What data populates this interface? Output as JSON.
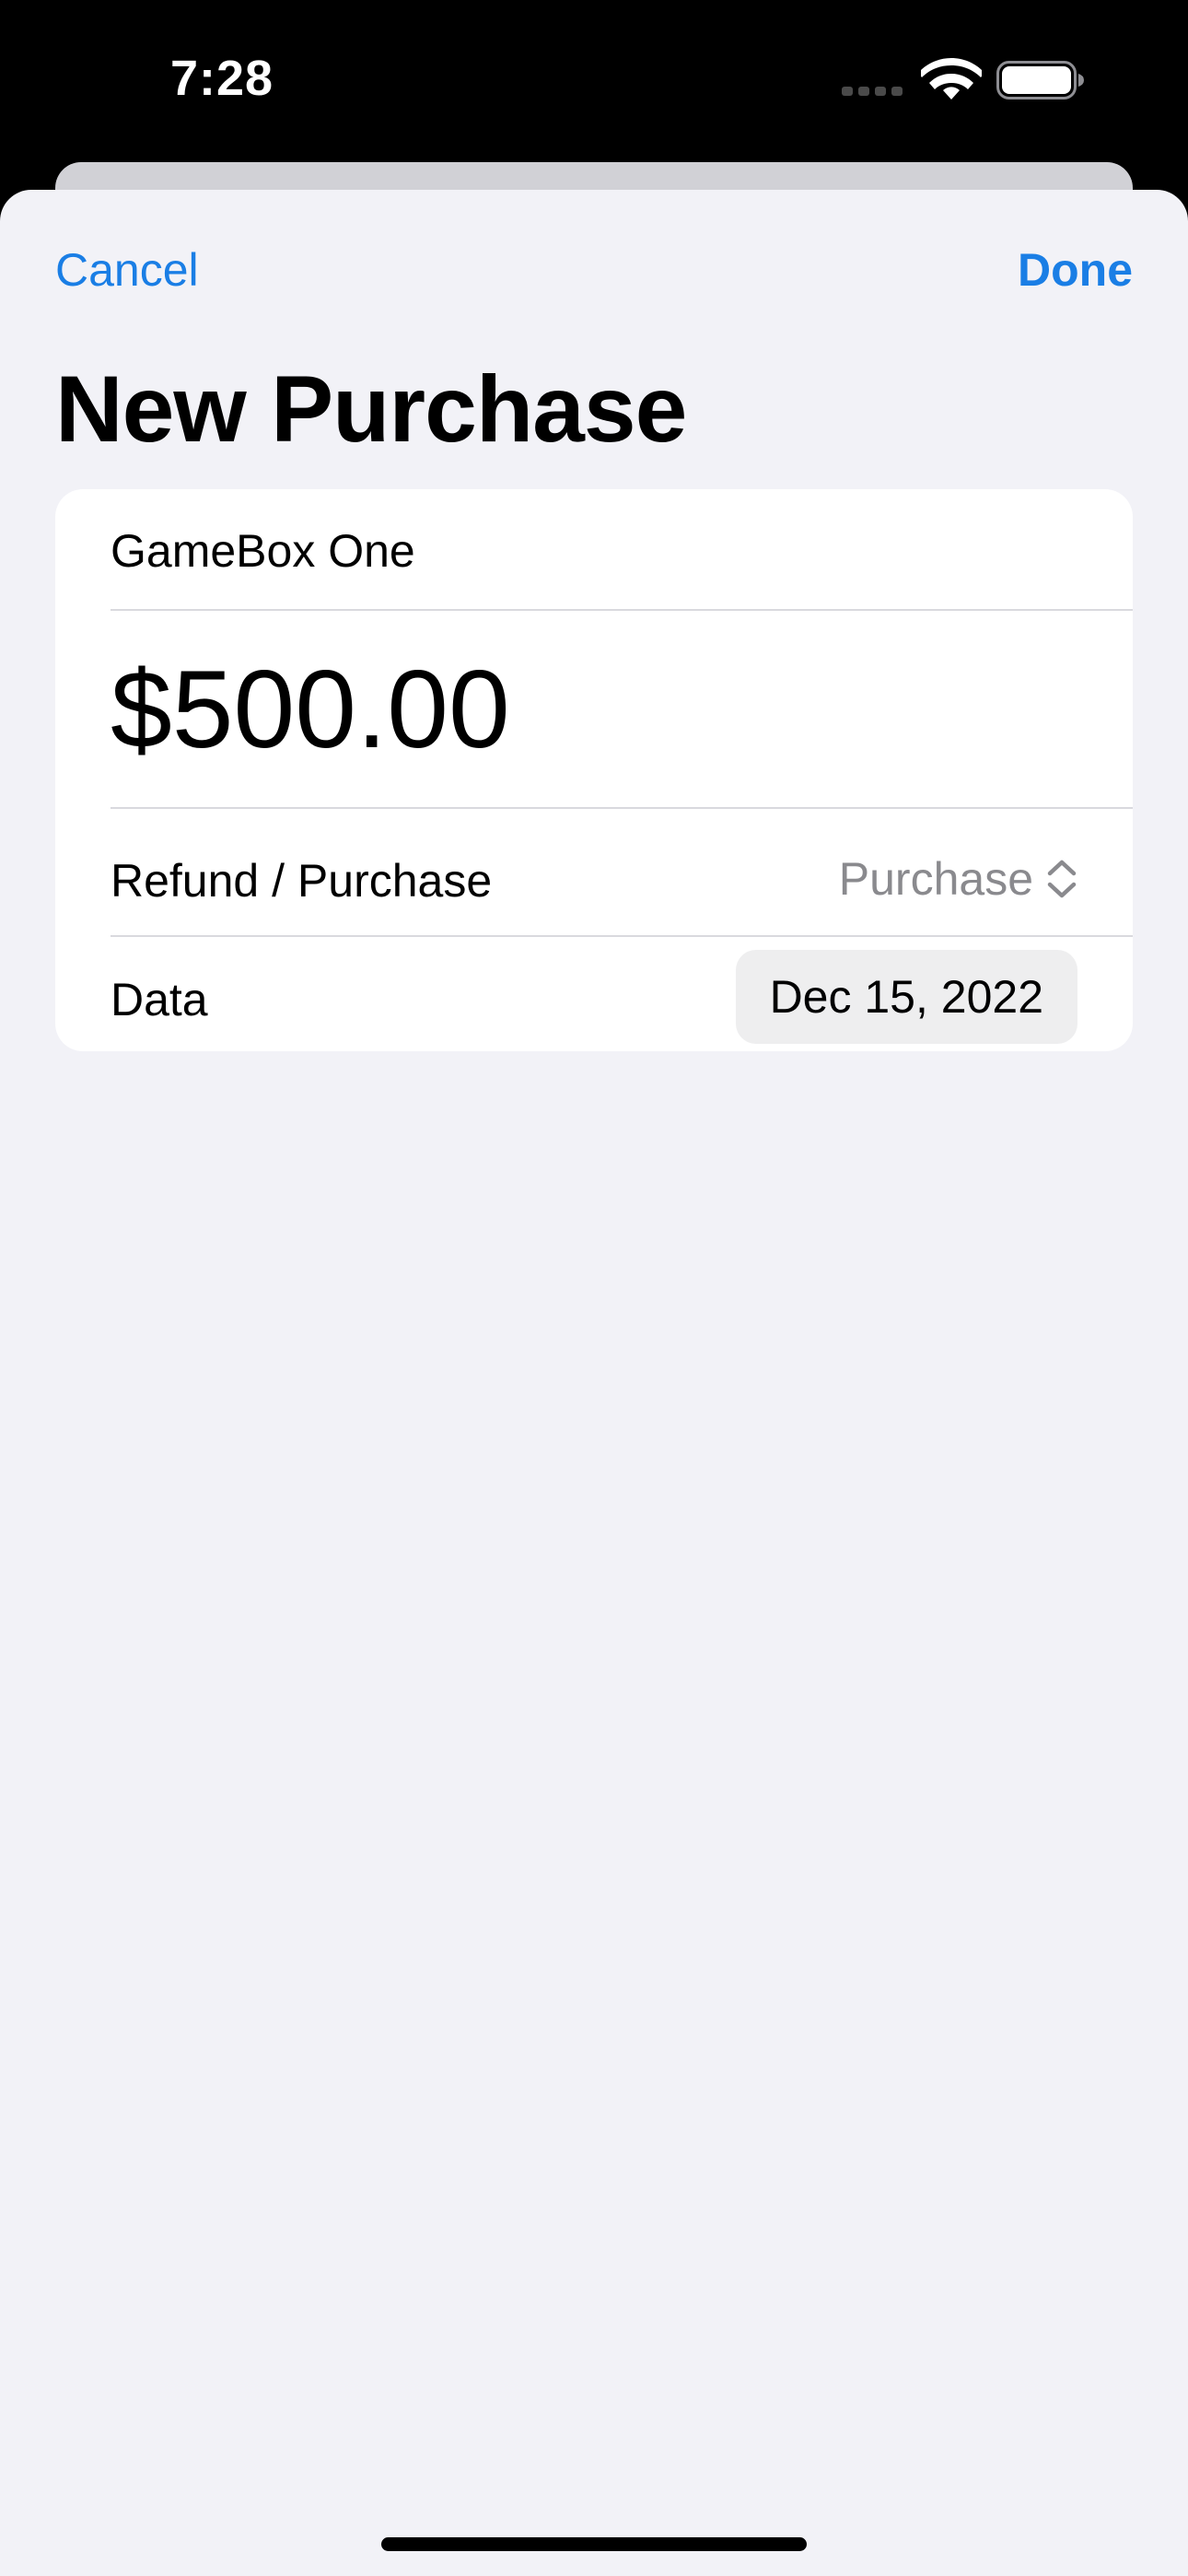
{
  "status_bar": {
    "time": "7:28"
  },
  "nav": {
    "cancel_label": "Cancel",
    "done_label": "Done"
  },
  "page": {
    "title": "New Purchase"
  },
  "form": {
    "name_value": "GameBox One",
    "amount_value": "$500.00",
    "type_label": "Refund / Purchase",
    "type_selected": "Purchase",
    "date_label": "Data",
    "date_value": "Dec 15, 2022"
  },
  "colors": {
    "accent": "#1a7ee5",
    "sheet_background": "#f2f2f7",
    "card_background": "#ffffff",
    "secondary_text": "#8a8a8e"
  },
  "icons": {
    "wifi": "wifi-icon",
    "battery": "battery-icon",
    "cell_signal": "cell-signal-icon",
    "picker_chevron": "chevron-updown-icon"
  }
}
